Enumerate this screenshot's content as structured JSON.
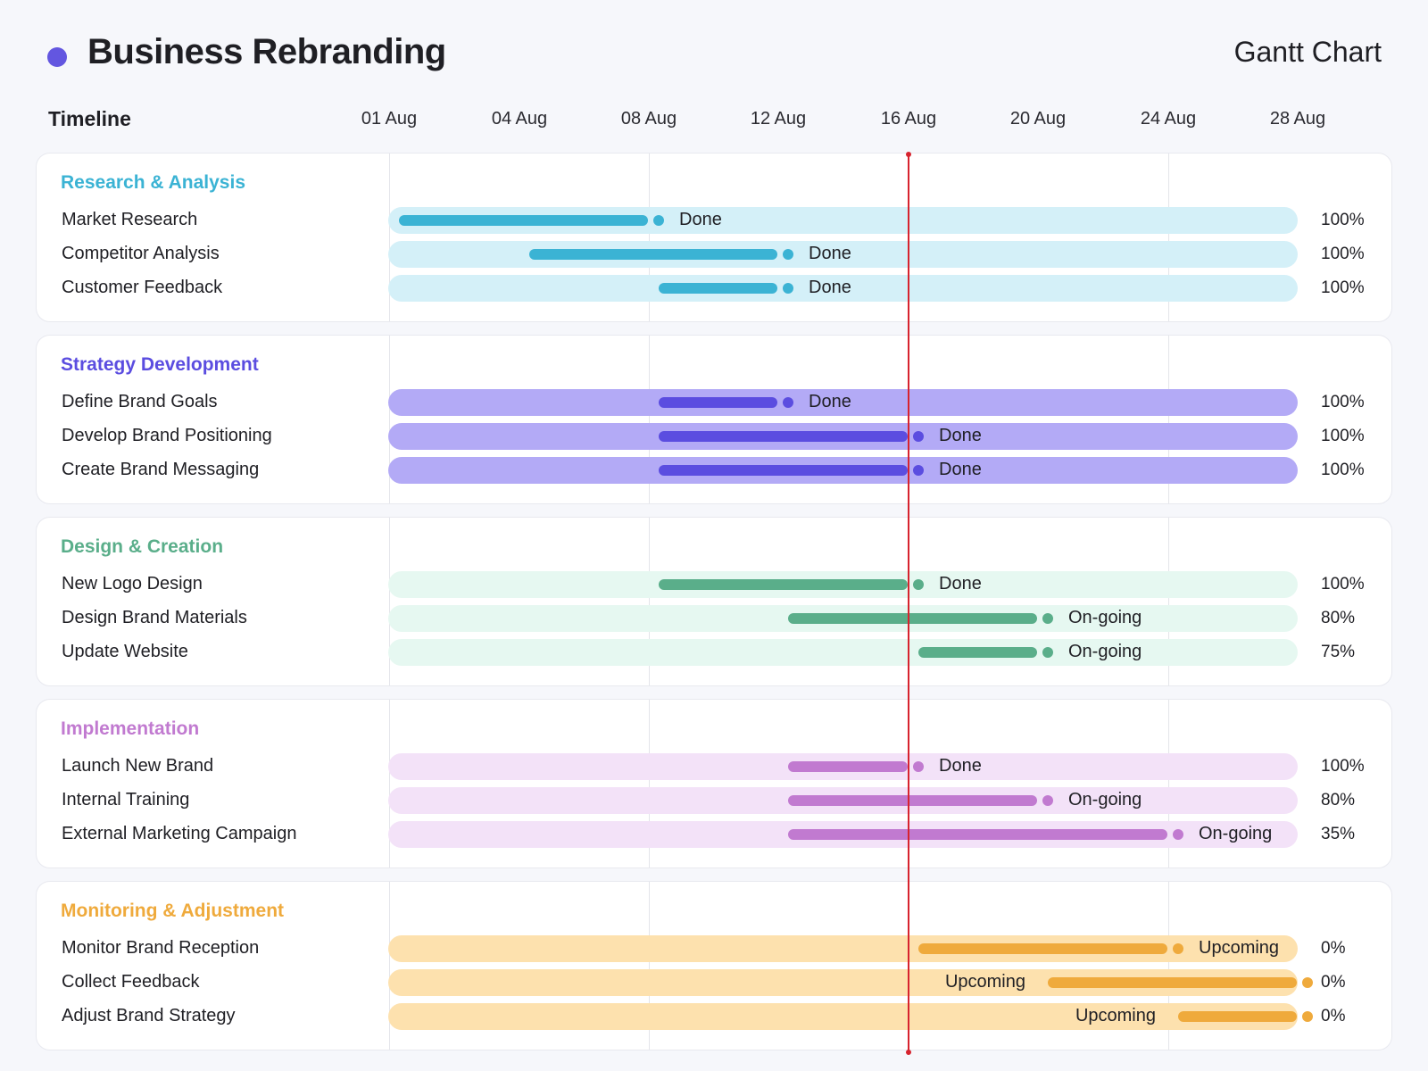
{
  "header": {
    "title": "Business Rebranding",
    "subtitle": "Gantt Chart",
    "accent_color": "#6356e0"
  },
  "chart_data": {
    "type": "gantt",
    "title": "Business Rebranding",
    "subtitle": "Gantt Chart",
    "timeline_label": "Timeline",
    "ticks": [
      "01 Aug",
      "04 Aug",
      "08 Aug",
      "12 Aug",
      "16 Aug",
      "20 Aug",
      "24 Aug",
      "28 Aug"
    ],
    "today_marker": "16 Aug",
    "groups": [
      {
        "name": "Research & Analysis",
        "color": "#3bb3d4",
        "track_color": "#d4f0f8",
        "tasks": [
          {
            "name": "Market Research",
            "start": "01 Aug",
            "end": "08 Aug",
            "status": "Done",
            "progress": "100%"
          },
          {
            "name": "Competitor Analysis",
            "start": "04 Aug",
            "end": "12 Aug",
            "status": "Done",
            "progress": "100%"
          },
          {
            "name": "Customer Feedback",
            "start": "08 Aug",
            "end": "12 Aug",
            "status": "Done",
            "progress": "100%"
          }
        ]
      },
      {
        "name": "Strategy Development",
        "color": "#5b4de0",
        "track_color": "#b3aaf6",
        "tasks": [
          {
            "name": "Define Brand Goals",
            "start": "08 Aug",
            "end": "12 Aug",
            "status": "Done",
            "progress": "100%"
          },
          {
            "name": "Develop Brand Positioning",
            "start": "08 Aug",
            "end": "16 Aug",
            "status": "Done",
            "progress": "100%"
          },
          {
            "name": "Create Brand Messaging",
            "start": "08 Aug",
            "end": "16 Aug",
            "status": "Done",
            "progress": "100%"
          }
        ]
      },
      {
        "name": "Design & Creation",
        "color": "#5aae8a",
        "track_color": "#e6f8f1",
        "tasks": [
          {
            "name": "New Logo Design",
            "start": "08 Aug",
            "end": "16 Aug",
            "status": "Done",
            "progress": "100%"
          },
          {
            "name": "Design Brand Materials",
            "start": "12 Aug",
            "end": "20 Aug",
            "status": "On-going",
            "progress": "80%"
          },
          {
            "name": "Update Website",
            "start": "16 Aug",
            "end": "20 Aug",
            "status": "On-going",
            "progress": "75%"
          }
        ]
      },
      {
        "name": "Implementation",
        "color": "#c17ad0",
        "track_color": "#f3e2f8",
        "tasks": [
          {
            "name": "Launch New Brand",
            "start": "12 Aug",
            "end": "16 Aug",
            "status": "Done",
            "progress": "100%"
          },
          {
            "name": "Internal Training",
            "start": "12 Aug",
            "end": "20 Aug",
            "status": "On-going",
            "progress": "80%"
          },
          {
            "name": "External Marketing Campaign",
            "start": "12 Aug",
            "end": "24 Aug",
            "status": "On-going",
            "progress": "35%"
          }
        ]
      },
      {
        "name": "Monitoring & Adjustment",
        "color": "#efaa3c",
        "track_color": "#fde1ae",
        "tasks": [
          {
            "name": "Monitor Brand Reception",
            "start": "16 Aug",
            "end": "24 Aug",
            "status": "Upcoming",
            "progress": "0%"
          },
          {
            "name": "Collect Feedback",
            "start": "20 Aug",
            "end": "28 Aug",
            "status": "Upcoming",
            "progress": "0%"
          },
          {
            "name": "Adjust Brand Strategy",
            "start": "24 Aug",
            "end": "28 Aug",
            "status": "Upcoming",
            "progress": "0%"
          }
        ]
      }
    ]
  }
}
